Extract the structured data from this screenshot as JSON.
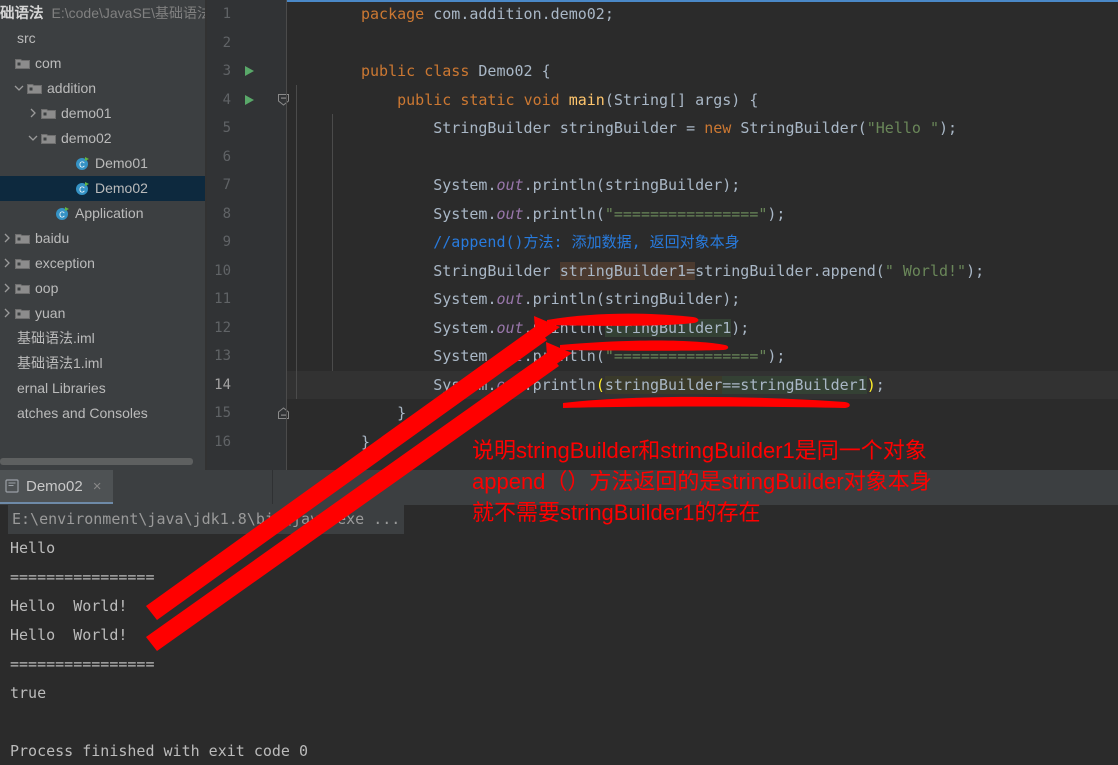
{
  "sidebar": {
    "root": {
      "name": "础语法",
      "path": "E:\\code\\JavaSE\\基础语法"
    },
    "items": [
      {
        "label": "src",
        "arrow": "none",
        "icon": "none",
        "indent": 0,
        "selected": false
      },
      {
        "label": "com",
        "arrow": "none",
        "icon": "folder",
        "indent": 0,
        "selected": false
      },
      {
        "label": "addition",
        "arrow": "down",
        "icon": "folder",
        "indent": 12,
        "selected": false
      },
      {
        "label": "demo01",
        "arrow": "right",
        "icon": "folder",
        "indent": 26,
        "selected": false
      },
      {
        "label": "demo02",
        "arrow": "down",
        "icon": "folder",
        "indent": 26,
        "selected": false
      },
      {
        "label": "Demo01",
        "arrow": "none",
        "icon": "java-class",
        "indent": 60,
        "selected": false
      },
      {
        "label": "Demo02",
        "arrow": "none",
        "icon": "java-class",
        "indent": 60,
        "selected": true
      },
      {
        "label": "Application",
        "arrow": "none",
        "icon": "java-class",
        "indent": 40,
        "selected": false
      },
      {
        "label": "baidu",
        "arrow": "right",
        "icon": "folder",
        "indent": 0,
        "selected": false
      },
      {
        "label": "exception",
        "arrow": "right",
        "icon": "folder",
        "indent": 0,
        "selected": false
      },
      {
        "label": "oop",
        "arrow": "right",
        "icon": "folder",
        "indent": 0,
        "selected": false
      },
      {
        "label": "yuan",
        "arrow": "right",
        "icon": "folder",
        "indent": 0,
        "selected": false
      },
      {
        "label": "基础语法.iml",
        "arrow": "none",
        "icon": "none",
        "indent": -8,
        "selected": false
      },
      {
        "label": "基础语法1.iml",
        "arrow": "none",
        "icon": "none",
        "indent": -8,
        "selected": false
      },
      {
        "label": "ernal Libraries",
        "arrow": "none",
        "icon": "none",
        "indent": -8,
        "selected": false
      },
      {
        "label": "atches and Consoles",
        "arrow": "none",
        "icon": "none",
        "indent": -8,
        "selected": false
      }
    ]
  },
  "editor": {
    "line_numbers": [
      "1",
      "2",
      "3",
      "4",
      "5",
      "6",
      "7",
      "8",
      "9",
      "10",
      "11",
      "12",
      "13",
      "14",
      "15",
      "16"
    ],
    "current_line": "14",
    "run_markers": [
      "3",
      "4"
    ],
    "code": [
      "package com.addition.demo02;",
      "",
      "public class Demo02 {",
      "    public static void main(String[] args) {",
      "        StringBuilder stringBuilder = new StringBuilder(\"Hello \");",
      "",
      "        System.out.println(stringBuilder);",
      "        System.out.println(\"================\");",
      "        //append()方法: 添加数据, 返回对象本身",
      "        StringBuilder stringBuilder1=stringBuilder.append(\" World!\");",
      "        System.out.println(stringBuilder);",
      "        System.out.println(stringBuilder1);",
      "        System.out.println(\"================\");",
      "        System.out.println(stringBuilder==stringBuilder1);",
      "    }",
      "}"
    ]
  },
  "run_panel": {
    "tab": {
      "label": "Demo02",
      "close": "×",
      "icon": "console-icon"
    },
    "console_lines": [
      "E:\\environment\\java\\jdk1.8\\bin\\java.exe ...",
      "Hello ",
      "================",
      "Hello  World!",
      "Hello  World!",
      "================",
      "true",
      "",
      "Process finished with exit code 0"
    ]
  },
  "annotations": {
    "color": "#ff0000",
    "notes": [
      "说明stringBuilder和stringBuilder1是同一个对象",
      "append（）方法返回的是stringBuilder对象本身",
      "就不需要stringBuilder1的存在"
    ]
  }
}
